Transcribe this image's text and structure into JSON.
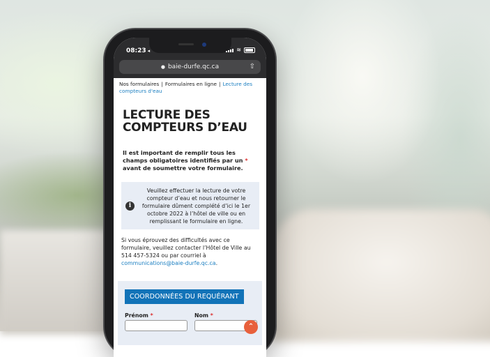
{
  "status_bar": {
    "time": "08:23",
    "location_arrow": "◂"
  },
  "browser": {
    "url": "baie-durfe.qc.ca",
    "lock_icon": "lock-icon",
    "share_icon": "share-icon"
  },
  "breadcrumb": {
    "items": [
      "Nos formulaires",
      "Formulaires en ligne",
      "Lecture des compteurs d'eau"
    ],
    "separator": "|"
  },
  "page_title": "LECTURE DES COMPTEURS D’EAU",
  "required_note": {
    "before": "Il est important de remplir tous les champs obligatoires identifiés par un ",
    "star": "*",
    "after": " avant de soumettre votre formulaire."
  },
  "info_box": {
    "text": "Veuillez effectuer la lecture de votre compteur d’eau et nous retourner le formulaire dûment complété d’ici le 1er octobre 2022 à l’hôtel de ville ou en remplissant le formulaire en ligne."
  },
  "contact": {
    "text": "Si vous éprouvez des difficultés avec ce formulaire, veuillez contacter l’Hôtel de Ville au 514 457-5324 ou par courriel à ",
    "email": "communications@baie-durfe.qc.ca",
    "end": "."
  },
  "form": {
    "section_title": "COORDONNÉES DU REQUÉRANT",
    "fields": [
      {
        "label": "Prénom",
        "required_mark": "*",
        "value": ""
      },
      {
        "label": "Nom",
        "required_mark": "*",
        "value": ""
      }
    ]
  },
  "scroll_top_icon": "chevron-up-icon",
  "colors": {
    "accent": "#1273b8",
    "link": "#1c7fc1",
    "required": "#dd3333",
    "scroll_button": "#e8603c"
  }
}
